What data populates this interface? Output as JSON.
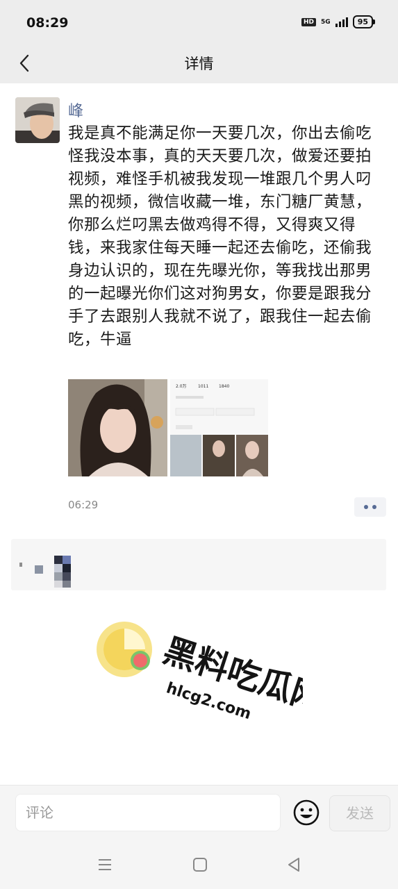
{
  "status_bar": {
    "time": "08:29",
    "hd_badge": "HD",
    "network": "5G",
    "battery": "95"
  },
  "nav": {
    "title": "详情",
    "back_icon": "chevron-left-icon"
  },
  "post": {
    "author": "峰",
    "text": "我是真不能满足你一天要几次，你出去偷吃怪我没本事，真的天天要几次，做爱还要拍视频，难怪手机被我发现一堆跟几个男人叼黑的视频，微信收藏一堆，东门糖厂黄慧，你那么烂叼黑去做鸡得不得，又得爽又得钱，来我家住每天睡一起还去偷吃，还偷我身边认识的，现在先曝光你，等我找出那男的一起曝光你们这对狗男女，你要是跟我分手了去跟别人我就不说了，跟我住一起去偷吃，牛逼",
    "time": "06:29",
    "screenshot_stats": [
      "2.0万",
      "1011",
      "1840"
    ]
  },
  "watermark": {
    "brand": "黑料吃瓜网",
    "url": "hlcg2.com"
  },
  "comment_bar": {
    "placeholder": "评论",
    "send_label": "发送",
    "emoji_icon": "smiley-icon"
  },
  "system_nav": {
    "menu_icon": "menu-icon",
    "home_icon": "home-square-icon",
    "back_icon": "back-triangle-icon"
  }
}
